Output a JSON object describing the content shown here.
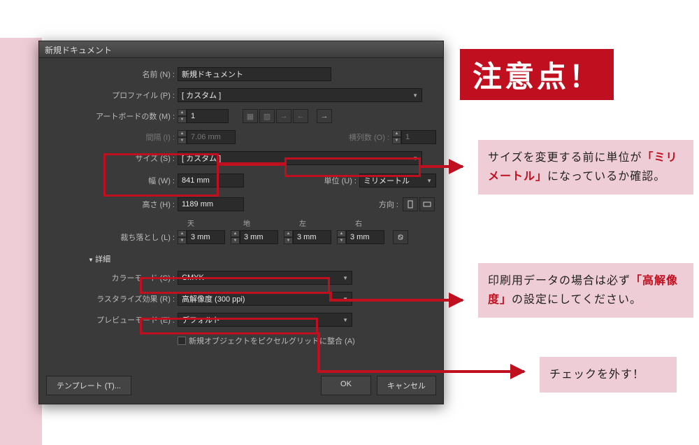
{
  "dialog": {
    "title": "新規ドキュメント",
    "name_label": "名前 (N) :",
    "name_value": "新規ドキュメント",
    "profile_label": "プロファイル (P) :",
    "profile_value": "[ カスタム ]",
    "artboards_label": "アートボードの数 (M) :",
    "artboards_value": "1",
    "spacing_label": "間隔 (I) :",
    "spacing_value": "7.06 mm",
    "columns_label": "横列数 (O) :",
    "columns_value": "1",
    "size_label": "サイズ (S) :",
    "size_value": "[ カスタム ]",
    "width_label": "幅 (W) :",
    "width_value": "841 mm",
    "units_label": "単位 (U) :",
    "units_value": "ミリメートル",
    "height_label": "高さ (H) :",
    "height_value": "1189 mm",
    "orient_label": "方向 :",
    "bleed_label": "裁ち落とし (L) :",
    "bleed_top": "天",
    "bleed_bottom": "地",
    "bleed_left": "左",
    "bleed_right": "右",
    "bleed_value": "3 mm",
    "advanced": "詳細",
    "colormode_label": "カラーモード (C) :",
    "colormode_value": "CMYK",
    "raster_label": "ラスタライズ効果 (R) :",
    "raster_value": "高解像度 (300 ppi)",
    "preview_label": "プレビューモード (E) :",
    "preview_value": "デフォルト",
    "align_pixel_label": "新規オブジェクトをピクセルグリッドに整合 (A)",
    "template_btn": "テンプレート (T)...",
    "ok_btn": "OK",
    "cancel_btn": "キャンセル"
  },
  "callout": {
    "title": "注意点！",
    "note1_a": "サイズを変更する前に単位が",
    "note1_em": "「ミリメートル」",
    "note1_b": "になっているか確認。",
    "note2_a": "印刷用データの場合は必ず",
    "note2_em": "「高解像度」",
    "note2_b": "の設定にしてください。",
    "note3": "チェックを外す！"
  }
}
